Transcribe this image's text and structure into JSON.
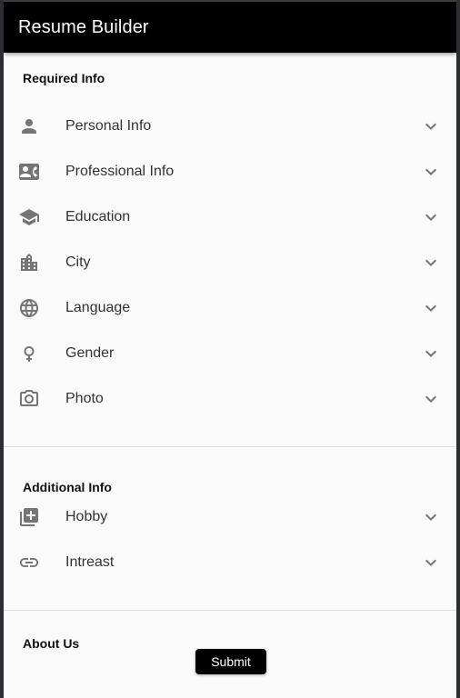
{
  "appbar": {
    "title": "Resume Builder"
  },
  "required": {
    "title": "Required Info",
    "items": [
      {
        "label": "Personal Info",
        "icon": "person-icon"
      },
      {
        "label": "Professional Info",
        "icon": "contact-card-icon"
      },
      {
        "label": "Education",
        "icon": "school-icon"
      },
      {
        "label": "City",
        "icon": "city-icon"
      },
      {
        "label": "Language",
        "icon": "globe-icon"
      },
      {
        "label": "Gender",
        "icon": "female-icon"
      },
      {
        "label": "Photo",
        "icon": "camera-icon"
      }
    ]
  },
  "additional": {
    "title": "Additional Info",
    "items": [
      {
        "label": "Hobby",
        "icon": "library-add-icon"
      },
      {
        "label": "Intreast",
        "icon": "link-icon"
      }
    ]
  },
  "about": {
    "title": "About Us"
  },
  "actions": {
    "submit_label": "Submit"
  },
  "colors": {
    "appbar": "#000000",
    "background": "#fafafa",
    "icon": "#757575"
  }
}
